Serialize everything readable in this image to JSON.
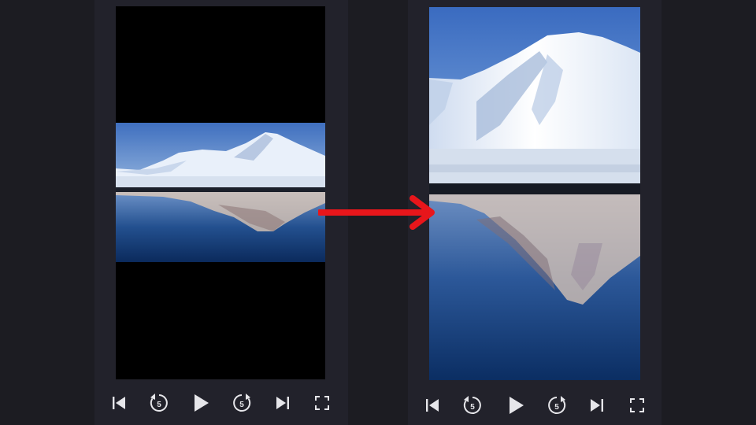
{
  "players": [
    {
      "id": "original",
      "controls": {
        "skip_back_icon": "skip-to-start-icon",
        "rewind_icon": "replay-5-icon",
        "rewind_seconds": "5",
        "play_icon": "play-icon",
        "forward_icon": "forward-5-icon",
        "forward_seconds": "5",
        "skip_forward_icon": "skip-to-end-icon",
        "fullscreen_icon": "fullscreen-icon"
      }
    },
    {
      "id": "cropped",
      "controls": {
        "skip_back_icon": "skip-to-start-icon",
        "rewind_icon": "replay-5-icon",
        "rewind_seconds": "5",
        "play_icon": "play-icon",
        "forward_icon": "forward-5-icon",
        "forward_seconds": "5",
        "skip_forward_icon": "skip-to-end-icon",
        "fullscreen_icon": "fullscreen-icon"
      }
    }
  ],
  "colors": {
    "background": "#1c1c22",
    "panel": "#22222b",
    "letterbox": "#000000",
    "arrow": "#e8161b",
    "control_icon": "#e6e6ea"
  }
}
